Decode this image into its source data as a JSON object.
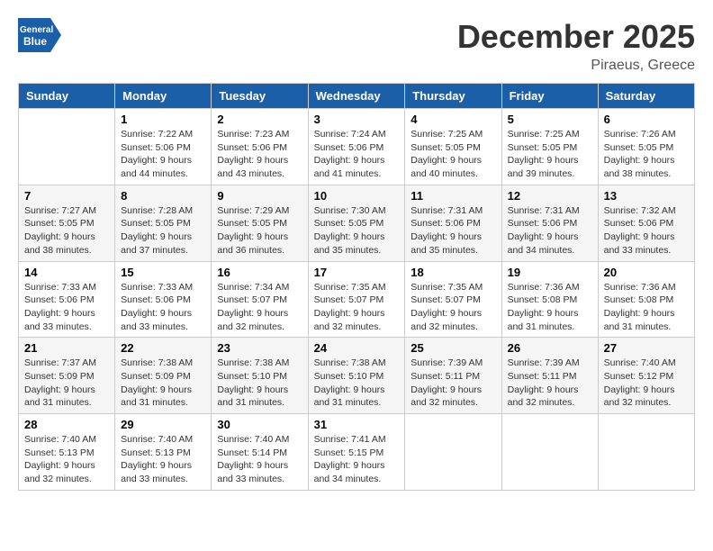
{
  "header": {
    "logo_text_general": "General",
    "logo_text_blue": "Blue",
    "month": "December 2025",
    "location": "Piraeus, Greece"
  },
  "calendar": {
    "days_of_week": [
      "Sunday",
      "Monday",
      "Tuesday",
      "Wednesday",
      "Thursday",
      "Friday",
      "Saturday"
    ],
    "weeks": [
      [
        {
          "day": "",
          "info": ""
        },
        {
          "day": "1",
          "info": "Sunrise: 7:22 AM\nSunset: 5:06 PM\nDaylight: 9 hours\nand 44 minutes."
        },
        {
          "day": "2",
          "info": "Sunrise: 7:23 AM\nSunset: 5:06 PM\nDaylight: 9 hours\nand 43 minutes."
        },
        {
          "day": "3",
          "info": "Sunrise: 7:24 AM\nSunset: 5:06 PM\nDaylight: 9 hours\nand 41 minutes."
        },
        {
          "day": "4",
          "info": "Sunrise: 7:25 AM\nSunset: 5:05 PM\nDaylight: 9 hours\nand 40 minutes."
        },
        {
          "day": "5",
          "info": "Sunrise: 7:25 AM\nSunset: 5:05 PM\nDaylight: 9 hours\nand 39 minutes."
        },
        {
          "day": "6",
          "info": "Sunrise: 7:26 AM\nSunset: 5:05 PM\nDaylight: 9 hours\nand 38 minutes."
        }
      ],
      [
        {
          "day": "7",
          "info": "Sunrise: 7:27 AM\nSunset: 5:05 PM\nDaylight: 9 hours\nand 38 minutes."
        },
        {
          "day": "8",
          "info": "Sunrise: 7:28 AM\nSunset: 5:05 PM\nDaylight: 9 hours\nand 37 minutes."
        },
        {
          "day": "9",
          "info": "Sunrise: 7:29 AM\nSunset: 5:05 PM\nDaylight: 9 hours\nand 36 minutes."
        },
        {
          "day": "10",
          "info": "Sunrise: 7:30 AM\nSunset: 5:05 PM\nDaylight: 9 hours\nand 35 minutes."
        },
        {
          "day": "11",
          "info": "Sunrise: 7:31 AM\nSunset: 5:06 PM\nDaylight: 9 hours\nand 35 minutes."
        },
        {
          "day": "12",
          "info": "Sunrise: 7:31 AM\nSunset: 5:06 PM\nDaylight: 9 hours\nand 34 minutes."
        },
        {
          "day": "13",
          "info": "Sunrise: 7:32 AM\nSunset: 5:06 PM\nDaylight: 9 hours\nand 33 minutes."
        }
      ],
      [
        {
          "day": "14",
          "info": "Sunrise: 7:33 AM\nSunset: 5:06 PM\nDaylight: 9 hours\nand 33 minutes."
        },
        {
          "day": "15",
          "info": "Sunrise: 7:33 AM\nSunset: 5:06 PM\nDaylight: 9 hours\nand 33 minutes."
        },
        {
          "day": "16",
          "info": "Sunrise: 7:34 AM\nSunset: 5:07 PM\nDaylight: 9 hours\nand 32 minutes."
        },
        {
          "day": "17",
          "info": "Sunrise: 7:35 AM\nSunset: 5:07 PM\nDaylight: 9 hours\nand 32 minutes."
        },
        {
          "day": "18",
          "info": "Sunrise: 7:35 AM\nSunset: 5:07 PM\nDaylight: 9 hours\nand 32 minutes."
        },
        {
          "day": "19",
          "info": "Sunrise: 7:36 AM\nSunset: 5:08 PM\nDaylight: 9 hours\nand 31 minutes."
        },
        {
          "day": "20",
          "info": "Sunrise: 7:36 AM\nSunset: 5:08 PM\nDaylight: 9 hours\nand 31 minutes."
        }
      ],
      [
        {
          "day": "21",
          "info": "Sunrise: 7:37 AM\nSunset: 5:09 PM\nDaylight: 9 hours\nand 31 minutes."
        },
        {
          "day": "22",
          "info": "Sunrise: 7:38 AM\nSunset: 5:09 PM\nDaylight: 9 hours\nand 31 minutes."
        },
        {
          "day": "23",
          "info": "Sunrise: 7:38 AM\nSunset: 5:10 PM\nDaylight: 9 hours\nand 31 minutes."
        },
        {
          "day": "24",
          "info": "Sunrise: 7:38 AM\nSunset: 5:10 PM\nDaylight: 9 hours\nand 31 minutes."
        },
        {
          "day": "25",
          "info": "Sunrise: 7:39 AM\nSunset: 5:11 PM\nDaylight: 9 hours\nand 32 minutes."
        },
        {
          "day": "26",
          "info": "Sunrise: 7:39 AM\nSunset: 5:11 PM\nDaylight: 9 hours\nand 32 minutes."
        },
        {
          "day": "27",
          "info": "Sunrise: 7:40 AM\nSunset: 5:12 PM\nDaylight: 9 hours\nand 32 minutes."
        }
      ],
      [
        {
          "day": "28",
          "info": "Sunrise: 7:40 AM\nSunset: 5:13 PM\nDaylight: 9 hours\nand 32 minutes."
        },
        {
          "day": "29",
          "info": "Sunrise: 7:40 AM\nSunset: 5:13 PM\nDaylight: 9 hours\nand 33 minutes."
        },
        {
          "day": "30",
          "info": "Sunrise: 7:40 AM\nSunset: 5:14 PM\nDaylight: 9 hours\nand 33 minutes."
        },
        {
          "day": "31",
          "info": "Sunrise: 7:41 AM\nSunset: 5:15 PM\nDaylight: 9 hours\nand 34 minutes."
        },
        {
          "day": "",
          "info": ""
        },
        {
          "day": "",
          "info": ""
        },
        {
          "day": "",
          "info": ""
        }
      ]
    ]
  }
}
